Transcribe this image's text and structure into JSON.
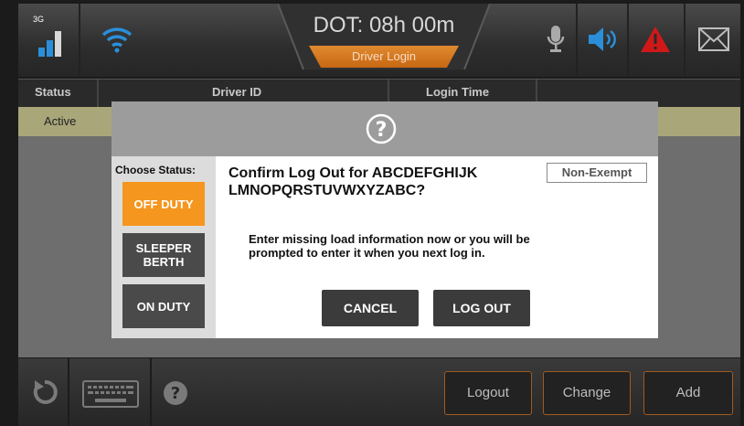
{
  "topbar": {
    "network_label": "3G",
    "dot_text": "DOT: 08h 00m",
    "screen_title": "Driver Login",
    "icons": [
      "signal-icon",
      "wifi-icon",
      "microphone-icon",
      "speaker-icon",
      "warning-icon",
      "mail-icon"
    ],
    "colors": {
      "accent_orange": "#e18a30",
      "signal_blue": "#2a8fd8",
      "warning_red": "#d01818"
    }
  },
  "table": {
    "headers": [
      "Status",
      "Driver ID",
      "Login Time"
    ],
    "rows": [
      [
        "Active",
        "",
        ""
      ]
    ]
  },
  "dialog": {
    "choose_label": "Choose Status:",
    "status_options": [
      "OFF DUTY",
      "SLEEPER BERTH",
      "ON DUTY"
    ],
    "selected_status": "OFF DUTY",
    "title_line1": "Confirm Log Out for ABCDEFGHIJK",
    "title_line2": "LMNOPQRSTUVWXYZABC?",
    "exempt_badge": "Non-Exempt",
    "message_line1": "Enter missing load information now or you will be",
    "message_line2": "prompted to enter it when you next log in.",
    "cancel_label": "CANCEL",
    "logout_label": "LOG OUT"
  },
  "bottombar": {
    "logout_label": "Logout",
    "change_label": "Change",
    "add_label": "Add",
    "icons": [
      "refresh-icon",
      "keyboard-icon",
      "help-icon"
    ]
  }
}
